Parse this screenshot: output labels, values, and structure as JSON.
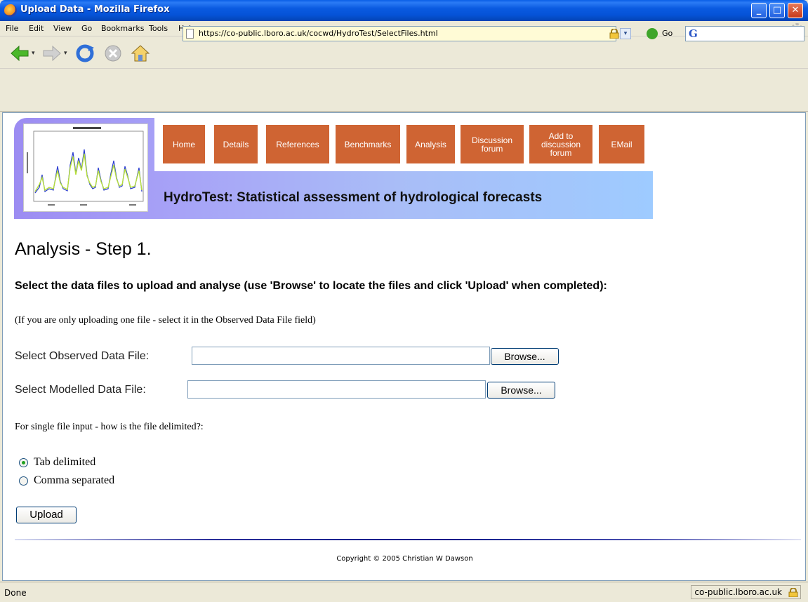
{
  "window": {
    "title": "Upload Data - Mozilla Firefox",
    "buttons": {
      "minimize": "_",
      "maximize": "□",
      "close": "✕"
    }
  },
  "menubar": {
    "items": [
      "File",
      "Edit",
      "View",
      "Go",
      "Bookmarks",
      "Tools",
      "Help"
    ]
  },
  "toolbar": {
    "url": "https://co-public.lboro.ac.uk/cocwd/HydroTest/SelectFiles.html",
    "go_label": "Go"
  },
  "site": {
    "nav": [
      "Home",
      "Details",
      "References",
      "Benchmarks",
      "Analysis",
      "Discussion forum",
      "Add to discussion forum",
      "EMail"
    ],
    "banner_title": "HydroTest: Statistical assessment of hydrological forecasts"
  },
  "page": {
    "title": "Analysis - Step 1.",
    "instructions": "Select the data files to upload and analyse (use 'Browse' to locate the files and click 'Upload' when completed):",
    "note": "(If you are only uploading one file - select it in the Observed Data File field)",
    "observed_label": "Select Observed Data File:",
    "modelled_label": "Select Modelled Data File:",
    "browse_label": "Browse...",
    "delimiter_question": "For single file input - how is the file delimited?:",
    "options": [
      {
        "label": "Tab delimited",
        "checked": true
      },
      {
        "label": "Comma separated",
        "checked": false
      }
    ],
    "upload_label": "Upload",
    "copyright": "Copyright © 2005 Christian W Dawson"
  },
  "statusbar": {
    "status": "Done",
    "host": "co-public.lboro.ac.uk"
  },
  "colors": {
    "nav_tab": "#cf6433",
    "titlebar": "#0a5ae0",
    "accent_radio": "#21a121"
  }
}
